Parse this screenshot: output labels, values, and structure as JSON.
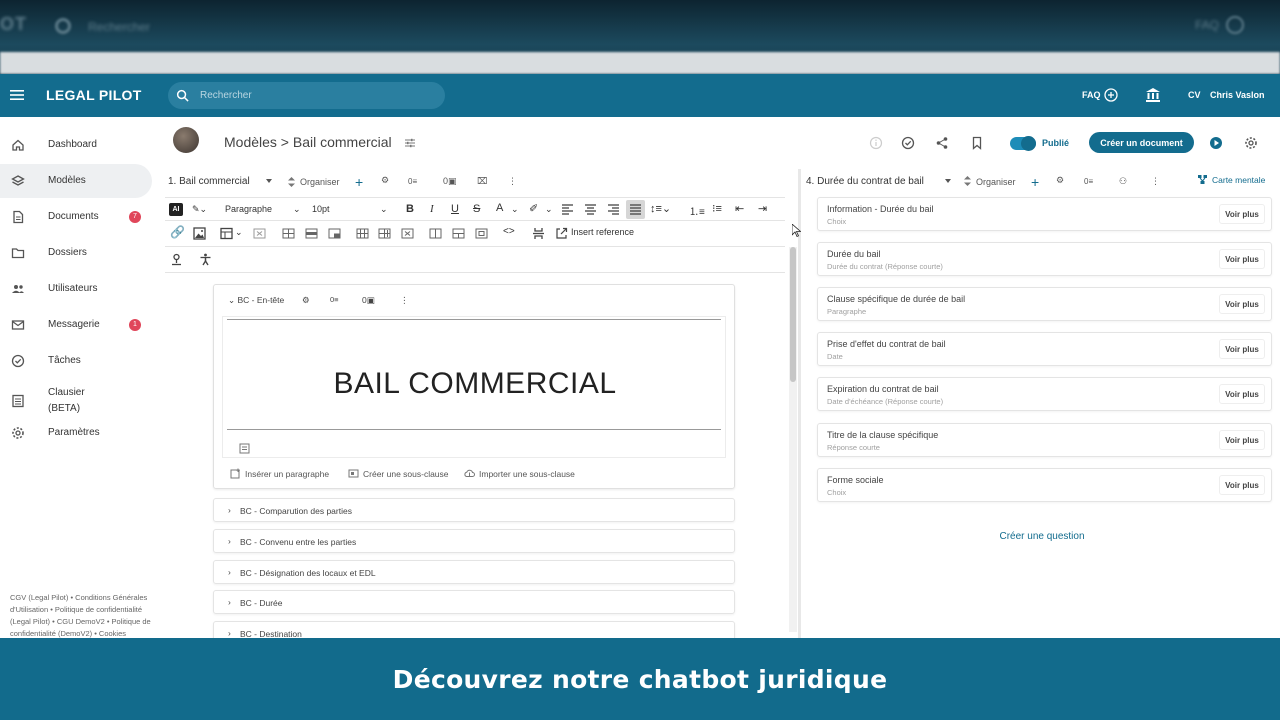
{
  "background": {
    "logo": "OT",
    "search_text": "Rechercher",
    "faq": "FAQ"
  },
  "topbar": {
    "logo": "LEGAL PILOT",
    "search_placeholder": "Rechercher",
    "faq": "FAQ",
    "initials": "CV",
    "username": "Chris Vaslon"
  },
  "sidebar": {
    "items": [
      {
        "label": "Dashboard",
        "icon": "home-icon"
      },
      {
        "label": "Modèles",
        "icon": "layers-icon",
        "active": true
      },
      {
        "label": "Documents",
        "icon": "document-icon",
        "badge": "7"
      },
      {
        "label": "Dossiers",
        "icon": "folder-icon"
      },
      {
        "label": "Utilisateurs",
        "icon": "users-icon"
      },
      {
        "label": "Messagerie",
        "icon": "mail-icon",
        "badge": "1"
      },
      {
        "label": "Tâches",
        "icon": "check-circle-icon"
      },
      {
        "label": "Clausier\n(BETA)",
        "icon": "list-icon"
      },
      {
        "label": "Paramètres",
        "icon": "gear-icon"
      }
    ],
    "footer": "CGV (Legal Pilot) • Conditions Générales d'Utilisation • Politique de confidentialité (Legal Pilot) • CGU DemoV2 • Politique de confidentialité (DemoV2) • Cookies"
  },
  "content": {
    "breadcrumb": "Modèles > Bail commercial",
    "published_label": "Publié",
    "create_document": "Créer un document"
  },
  "editor": {
    "section_selector": "1.  Bail commercial",
    "organize": "Organiser",
    "paragraph_style": "Paragraphe",
    "font_size": "10pt",
    "ai_label": "AI",
    "insert_reference": "Insert reference",
    "clause_header": "BC - En-tête",
    "doc_title": "BAIL COMMERCIAL",
    "actions": {
      "insert_paragraph": "Insérer un paragraphe",
      "create_subclause": "Créer une sous-clause",
      "import_subclause": "Importer une sous-clause"
    },
    "subclauses": [
      "BC - Comparution des parties",
      "BC - Convenu entre les parties",
      "BC - Désignation des locaux et EDL",
      "BC - Durée",
      "BC - Destination"
    ]
  },
  "panel": {
    "section_selector": "4.  Durée du contrat de bail",
    "organize": "Organiser",
    "mindmap": "Carte mentale",
    "see_more": "Voir plus",
    "questions": [
      {
        "title": "Information - Durée du bail",
        "type": "Choix"
      },
      {
        "title": "Durée du bail",
        "type": "Durée du contrat (Réponse courte)"
      },
      {
        "title": "Clause spécifique de durée de bail",
        "type": "Paragraphe"
      },
      {
        "title": "Prise d'effet du contrat de bail",
        "type": "Date"
      },
      {
        "title": "Expiration du contrat de bail",
        "type": "Date d'échéance (Réponse courte)"
      },
      {
        "title": "Titre de la clause spécifique",
        "type": "Réponse courte"
      },
      {
        "title": "Forme sociale",
        "type": "Choix"
      }
    ],
    "create_question": "Créer une question"
  },
  "caption": "Découvrez notre chatbot juridique",
  "colors": {
    "brand": "#136c8e",
    "badge": "#e0465a",
    "caption_bg": "#126b8c"
  }
}
